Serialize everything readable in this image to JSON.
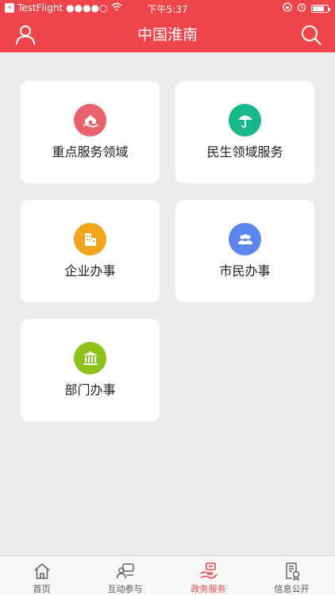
{
  "status_bar": {
    "carrier": "TestFlight",
    "signal": "●●●●○",
    "time": "下午5:37"
  },
  "header": {
    "title": "中国淮南",
    "left_icon": "user-icon",
    "right_icon": "search-icon"
  },
  "services": [
    {
      "label": "重点服务领域",
      "icon": "home-hand-icon",
      "color": "#e8636d"
    },
    {
      "label": "民生领域服务",
      "icon": "umbrella-icon",
      "color": "#17b889"
    },
    {
      "label": "企业办事",
      "icon": "building-icon",
      "color": "#f2a51c"
    },
    {
      "label": "市民办事",
      "icon": "people-icon",
      "color": "#5b86f0"
    },
    {
      "label": "部门办事",
      "icon": "bank-icon",
      "color": "#8cc21a"
    }
  ],
  "tabbar": {
    "active_color": "#f0454a",
    "items": [
      {
        "label": "首页",
        "icon": "home-icon"
      },
      {
        "label": "互动参与",
        "icon": "chat-icon"
      },
      {
        "label": "政务服务",
        "icon": "service-hand-icon",
        "active": true
      },
      {
        "label": "信息公开",
        "icon": "document-icon"
      }
    ]
  }
}
